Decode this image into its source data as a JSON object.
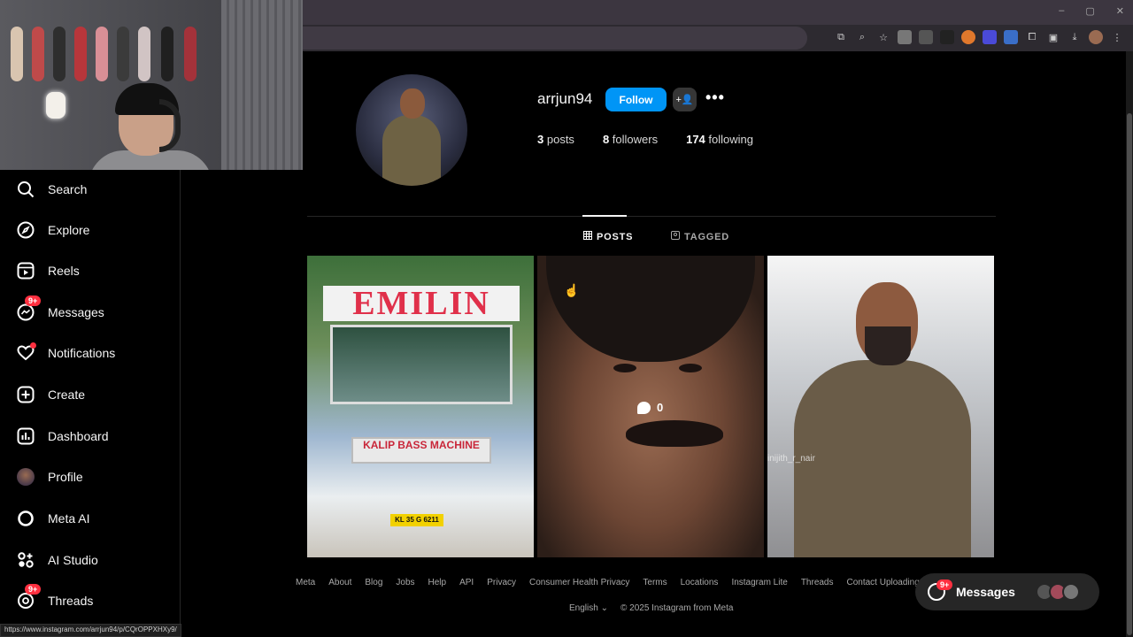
{
  "browser": {
    "window_controls": [
      "–",
      "▢",
      "✕"
    ],
    "extension_icons": [
      "cast-icon",
      "zoom-icon",
      "star-icon",
      "ext-1-icon",
      "ext-2-icon",
      "ext-3-icon",
      "ext-4-icon",
      "ext-5-icon",
      "ext-6-icon",
      "puzzle-icon",
      "media-icon",
      "download-icon",
      "profile-icon",
      "menu-icon"
    ],
    "status_url": "https://www.instagram.com/arrjun94/p/CQrOPPXHXy9/"
  },
  "sidebar": {
    "items": [
      {
        "label": "Search",
        "icon": "search-icon"
      },
      {
        "label": "Explore",
        "icon": "compass-icon"
      },
      {
        "label": "Reels",
        "icon": "reels-icon"
      },
      {
        "label": "Messages",
        "icon": "messenger-icon",
        "badge": "9+"
      },
      {
        "label": "Notifications",
        "icon": "heart-icon"
      },
      {
        "label": "Create",
        "icon": "plus-square-icon"
      },
      {
        "label": "Dashboard",
        "icon": "bar-chart-icon"
      },
      {
        "label": "Profile",
        "icon": "avatar-icon"
      },
      {
        "label": "Meta AI",
        "icon": "meta-ai-ring-icon"
      },
      {
        "label": "AI Studio",
        "icon": "ai-studio-icon"
      },
      {
        "label": "Threads",
        "icon": "threads-icon",
        "badge": "9+"
      }
    ]
  },
  "profile": {
    "username": "arrjun94",
    "follow_label": "Follow",
    "suggest_icon": "+👤",
    "more_label": "•••",
    "posts_count": "3",
    "posts_label": "posts",
    "followers_count": "8",
    "followers_label": "followers",
    "following_count": "174",
    "following_label": "following"
  },
  "tabs": {
    "posts": "POSTS",
    "tagged": "TAGGED"
  },
  "posts": [
    {
      "sign": "EMILIN",
      "grille": "KALIP BASS MACHINE",
      "plate": "KL 35 G 6211"
    },
    {
      "comments": "0"
    },
    {
      "watermark": "inijith_r_nair"
    }
  ],
  "footer": {
    "links": [
      "Meta",
      "About",
      "Blog",
      "Jobs",
      "Help",
      "API",
      "Privacy",
      "Consumer Health Privacy",
      "Terms",
      "Locations",
      "Instagram Lite",
      "Threads",
      "Contact Uploading & Non-Users"
    ],
    "language": "English",
    "copyright": "© 2025 Instagram from Meta"
  },
  "messages_pill": {
    "label": "Messages",
    "badge": "9+"
  },
  "colors": {
    "accent": "#0095f6",
    "badge": "#ff3040",
    "background": "#000000"
  }
}
